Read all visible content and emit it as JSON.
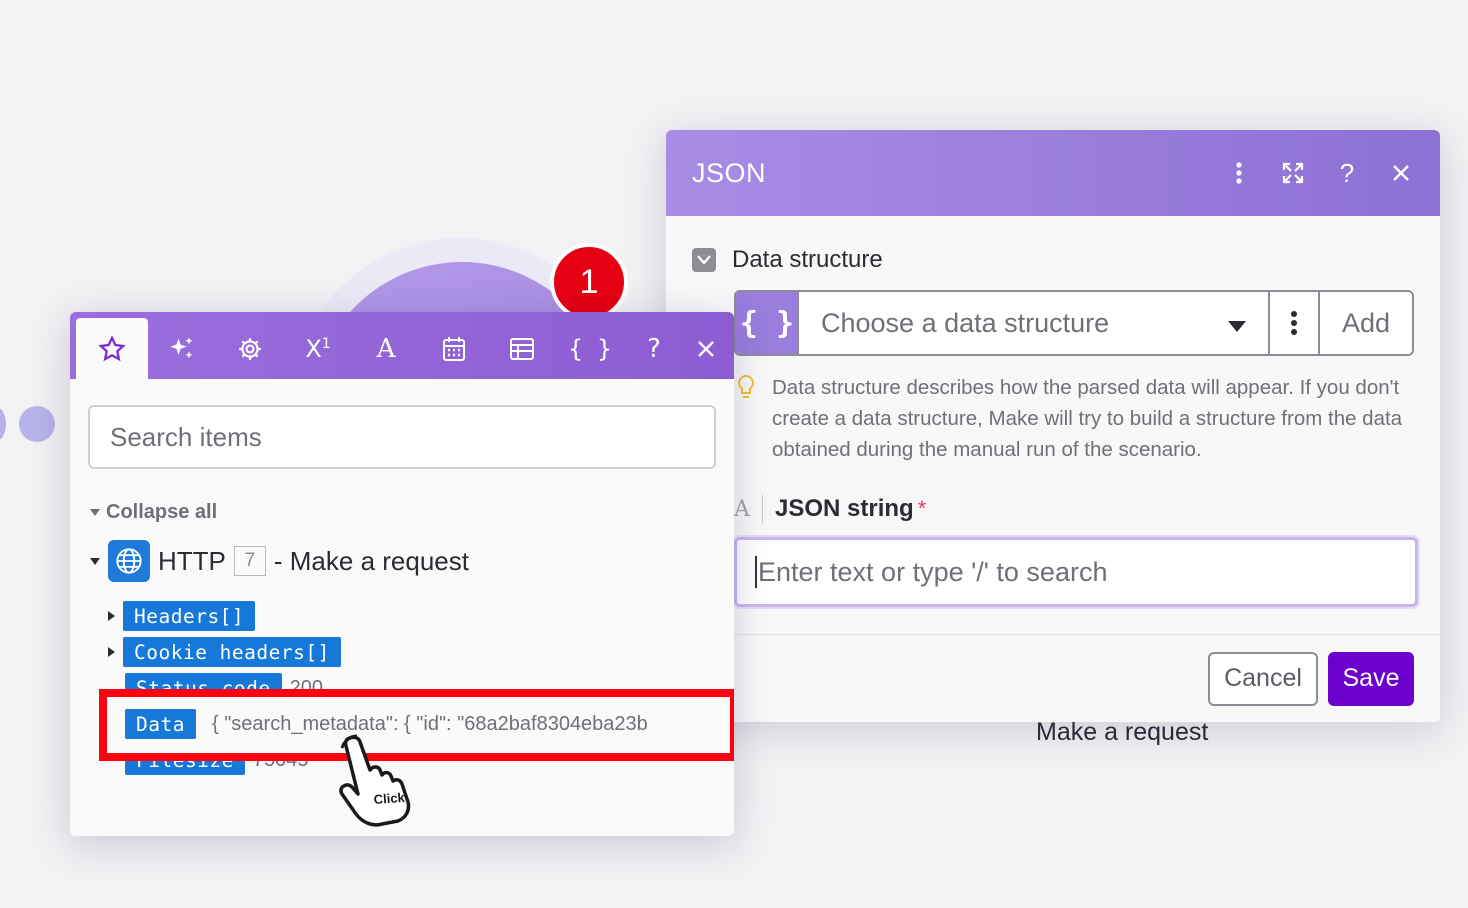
{
  "canvas": {
    "badge_count": "1",
    "module_label": "Make a request"
  },
  "json_dialog": {
    "title": "JSON",
    "header_icons": [
      "more-vertical-icon",
      "expand-icon",
      "help-icon",
      "close-icon"
    ],
    "data_structure": {
      "label": "Data structure",
      "placeholder": "Choose a data structure",
      "add_label": "Add"
    },
    "hint": "Data structure describes how the parsed data will appear. If you don't create a data structure, Make will try to build a structure from the data obtained during the manual run of the scenario.",
    "json_string": {
      "type_marker": "A",
      "label": "JSON string",
      "required_mark": "*",
      "placeholder": "Enter text or type '/' to search"
    },
    "cancel_label": "Cancel",
    "save_label": "Save"
  },
  "mapping_panel": {
    "toolbar_tabs": [
      "star-icon",
      "sparkle-icon",
      "gear-icon",
      "superscript-icon",
      "text-icon",
      "calendar-icon",
      "table-icon",
      "braces-icon",
      "help-icon",
      "close-icon"
    ],
    "search_placeholder": "Search items",
    "collapse_all": "Collapse all",
    "module": {
      "name": "HTTP",
      "number": "7",
      "description": "- Make a request"
    },
    "items": [
      {
        "name": "Headers[]",
        "value": ""
      },
      {
        "name": "Cookie headers[]",
        "value": ""
      },
      {
        "name": "Status code",
        "value": "200"
      },
      {
        "name": "Data",
        "value": "{ \"search_metadata\": { \"id\": \"68a2baf8304eba23b"
      },
      {
        "name": "Filesize",
        "value": "75045"
      }
    ],
    "cursor_label": "Click"
  },
  "colors": {
    "header_purple": "#9a7ddd",
    "save_purple": "#6d00cc",
    "pill_blue": "#1679d9",
    "highlight_red": "#ff0010",
    "badge_red": "#e60012"
  }
}
